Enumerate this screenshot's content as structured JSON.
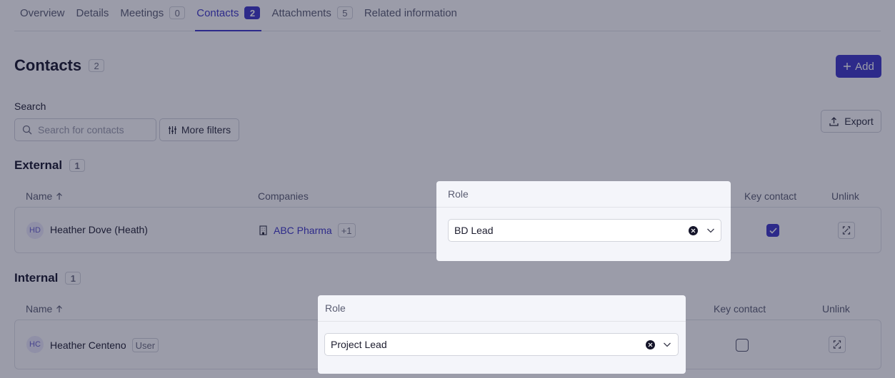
{
  "tabs": [
    {
      "label": "Overview"
    },
    {
      "label": "Details"
    },
    {
      "label": "Meetings",
      "count": "0"
    },
    {
      "label": "Contacts",
      "count": "2"
    },
    {
      "label": "Attachments",
      "count": "5"
    },
    {
      "label": "Related information"
    }
  ],
  "header": {
    "title": "Contacts",
    "count": "2",
    "add_label": "Add"
  },
  "search": {
    "label": "Search",
    "placeholder": "Search for contacts",
    "filters_label": "More filters",
    "export_label": "Export"
  },
  "external": {
    "title": "External",
    "count": "1",
    "columns": {
      "name": "Name",
      "companies": "Companies",
      "key_contact": "Key contact",
      "unlink": "Unlink"
    },
    "row": {
      "initials": "HD",
      "name": "Heather Dove (Heath)",
      "company": "ABC Pharma",
      "company_extra": "+1",
      "key_contact": true
    }
  },
  "internal": {
    "title": "Internal",
    "count": "1",
    "columns": {
      "name": "Name",
      "key_contact": "Key contact",
      "unlink": "Unlink"
    },
    "row": {
      "initials": "HC",
      "name": "Heather Centeno",
      "badge": "User",
      "key_contact": false
    }
  },
  "role_popover_external": {
    "title": "Role",
    "value": "BD Lead"
  },
  "role_popover_internal": {
    "title": "Role",
    "value": "Project Lead"
  },
  "colors": {
    "accent": "#3b35c8",
    "overlay": "rgba(28,30,60,0.44)"
  }
}
